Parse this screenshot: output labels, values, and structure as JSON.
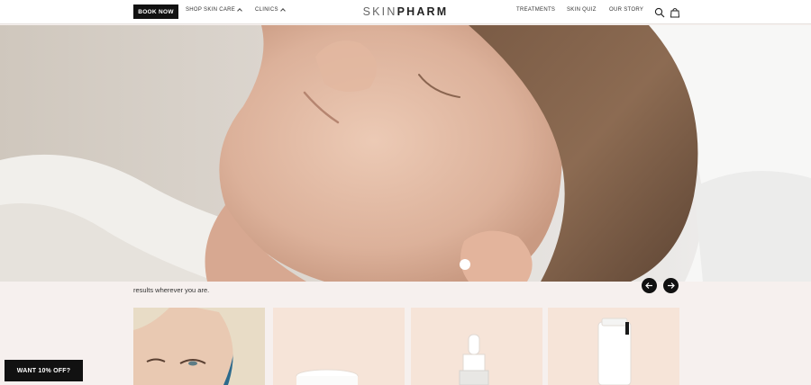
{
  "header": {
    "book_now": "BOOK NOW",
    "shop_skin_care": "SHOP SKIN CARE",
    "clinics": "CLINICS",
    "logo_light": "SKIN",
    "logo_bold": "PHARM",
    "treatments": "TREATMENTS",
    "skin_quiz": "SKIN QUIZ",
    "our_story": "OUR STORY",
    "search_icon": "search-icon",
    "bag_icon": "shopping-bag-icon"
  },
  "hero": {
    "caption": "results wherever you are."
  },
  "carousel": {
    "prev_icon": "arrow-left-icon",
    "next_icon": "arrow-right-icon"
  },
  "promo": {
    "label": "WANT 10% OFF?"
  },
  "colors": {
    "brand_black": "#111111",
    "background": "#f6f0ee",
    "card_peach": "#f6e4d8"
  }
}
